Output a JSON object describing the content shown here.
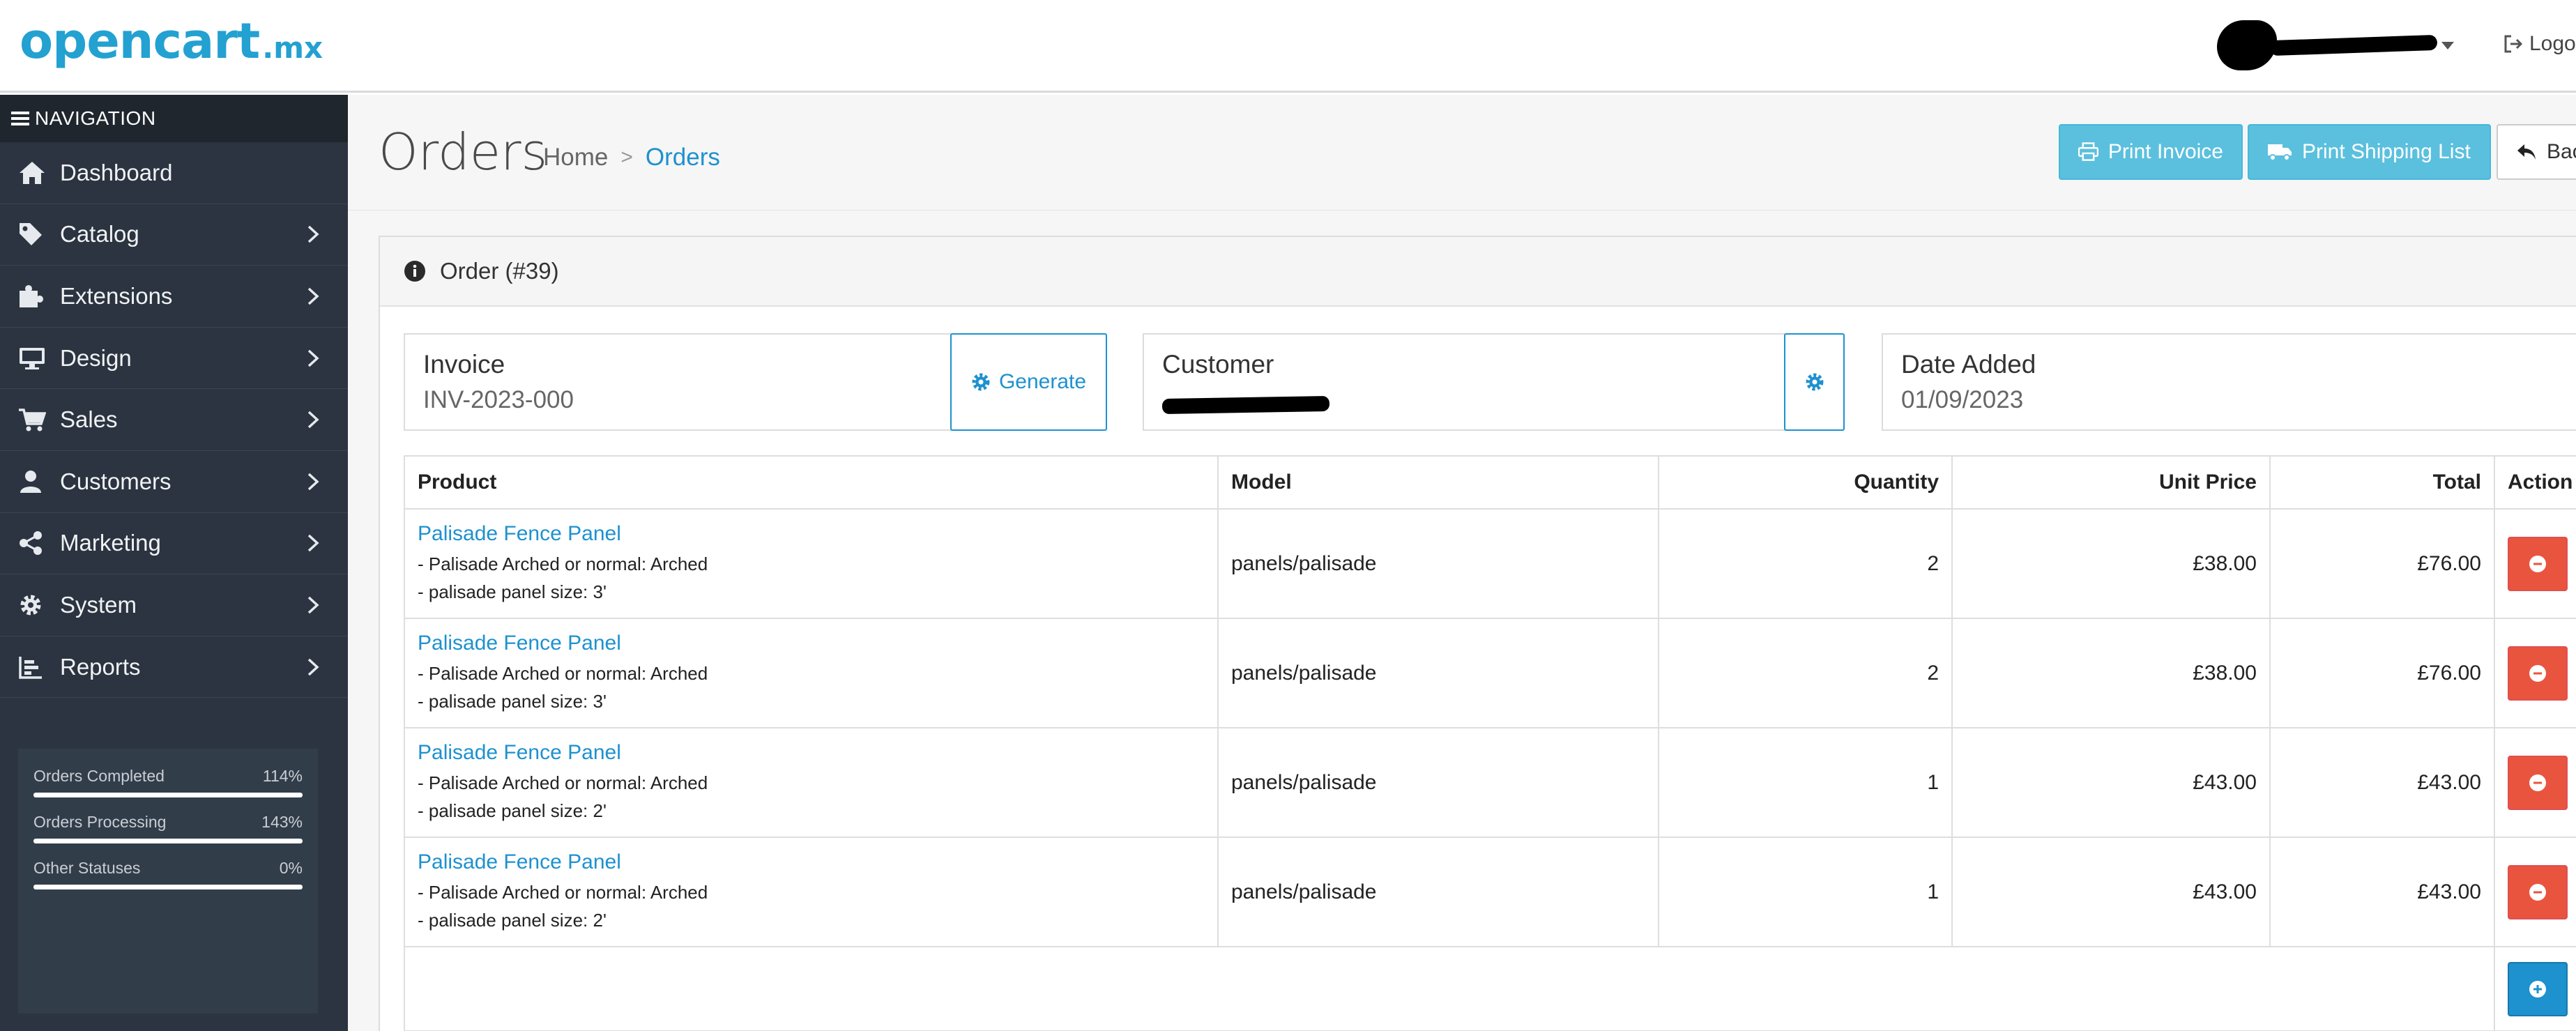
{
  "header": {
    "logo_brand": "opencart",
    "logo_tld": ".mx",
    "logout_label": "Logo"
  },
  "navigation": {
    "heading": "NAVIGATION",
    "items": [
      {
        "label": "Dashboard",
        "icon": "home-icon"
      },
      {
        "label": "Catalog",
        "icon": "tag-icon"
      },
      {
        "label": "Extensions",
        "icon": "puzzle-icon"
      },
      {
        "label": "Design",
        "icon": "monitor-icon"
      },
      {
        "label": "Sales",
        "icon": "cart-icon"
      },
      {
        "label": "Customers",
        "icon": "user-icon"
      },
      {
        "label": "Marketing",
        "icon": "share-icon"
      },
      {
        "label": "System",
        "icon": "gear-icon"
      },
      {
        "label": "Reports",
        "icon": "bar-chart-icon"
      }
    ]
  },
  "stats": [
    {
      "label": "Orders Completed",
      "value": "114%",
      "fill": 1.0
    },
    {
      "label": "Orders Processing",
      "value": "143%",
      "fill": 1.0
    },
    {
      "label": "Other Statuses",
      "value": "0%",
      "fill": 1.0
    }
  ],
  "page": {
    "title": "Orders",
    "breadcrumb": {
      "home": "Home",
      "current": "Orders"
    },
    "buttons": {
      "print_invoice": "Print Invoice",
      "print_shipping": "Print Shipping List",
      "back": "Bac"
    }
  },
  "panel": {
    "heading": "Order (#39)",
    "invoice": {
      "label": "Invoice",
      "value": "INV-2023-000",
      "generate_label": "Generate"
    },
    "customer": {
      "label": "Customer"
    },
    "date_added": {
      "label": "Date Added",
      "value": "01/09/2023"
    }
  },
  "table": {
    "headers": {
      "product": "Product",
      "model": "Model",
      "quantity": "Quantity",
      "unit_price": "Unit Price",
      "total": "Total",
      "action": "Action"
    },
    "rows": [
      {
        "name": "Palisade Fence Panel",
        "opt1": "- Palisade Arched or normal: Arched",
        "opt2": "- palisade panel size: 3'",
        "model": "panels/palisade",
        "qty": "2",
        "unit": "£38.00",
        "total": "£76.00"
      },
      {
        "name": "Palisade Fence Panel",
        "opt1": "- Palisade Arched or normal: Arched",
        "opt2": "- palisade panel size: 3'",
        "model": "panels/palisade",
        "qty": "2",
        "unit": "£38.00",
        "total": "£76.00"
      },
      {
        "name": "Palisade Fence Panel",
        "opt1": "- Palisade Arched or normal: Arched",
        "opt2": "- palisade panel size: 2'",
        "model": "panels/palisade",
        "qty": "1",
        "unit": "£43.00",
        "total": "£43.00"
      },
      {
        "name": "Palisade Fence Panel",
        "opt1": "- Palisade Arched or normal: Arched",
        "opt2": "- palisade panel size: 2'",
        "model": "panels/palisade",
        "qty": "1",
        "unit": "£43.00",
        "total": "£43.00"
      }
    ]
  },
  "colors": {
    "brand": "#23a1d1",
    "sidebar": "#2b3440",
    "link": "#1e91cf",
    "info_button": "#5bc0de",
    "danger": "#e9543f"
  }
}
